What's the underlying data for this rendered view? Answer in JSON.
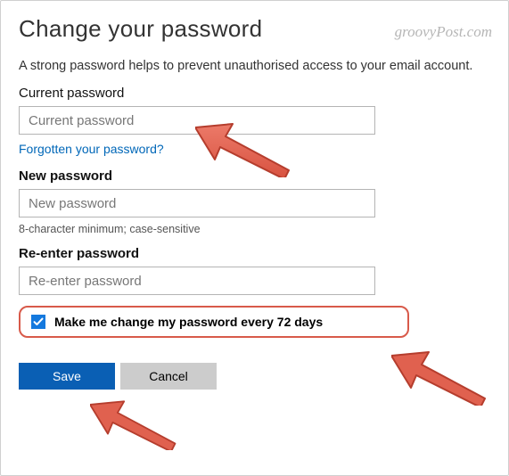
{
  "header": {
    "title": "Change your password",
    "watermark": "groovyPost.com"
  },
  "intro": "A strong password helps to prevent unauthorised access to your email account.",
  "fields": {
    "current": {
      "label": "Current password",
      "placeholder": "Current password",
      "value": ""
    },
    "forgot_link": "Forgotten your password?",
    "new": {
      "label": "New password",
      "placeholder": "New password",
      "value": ""
    },
    "new_hint": "8-character minimum; case-sensitive",
    "reenter": {
      "label": "Re-enter password",
      "placeholder": "Re-enter password",
      "value": ""
    }
  },
  "expire": {
    "checked": true,
    "label": "Make me change my password every 72 days"
  },
  "buttons": {
    "save": "Save",
    "cancel": "Cancel"
  },
  "annotation": {
    "arrow_fill": "#e0614f",
    "arrow_stroke": "#b33c2c"
  }
}
